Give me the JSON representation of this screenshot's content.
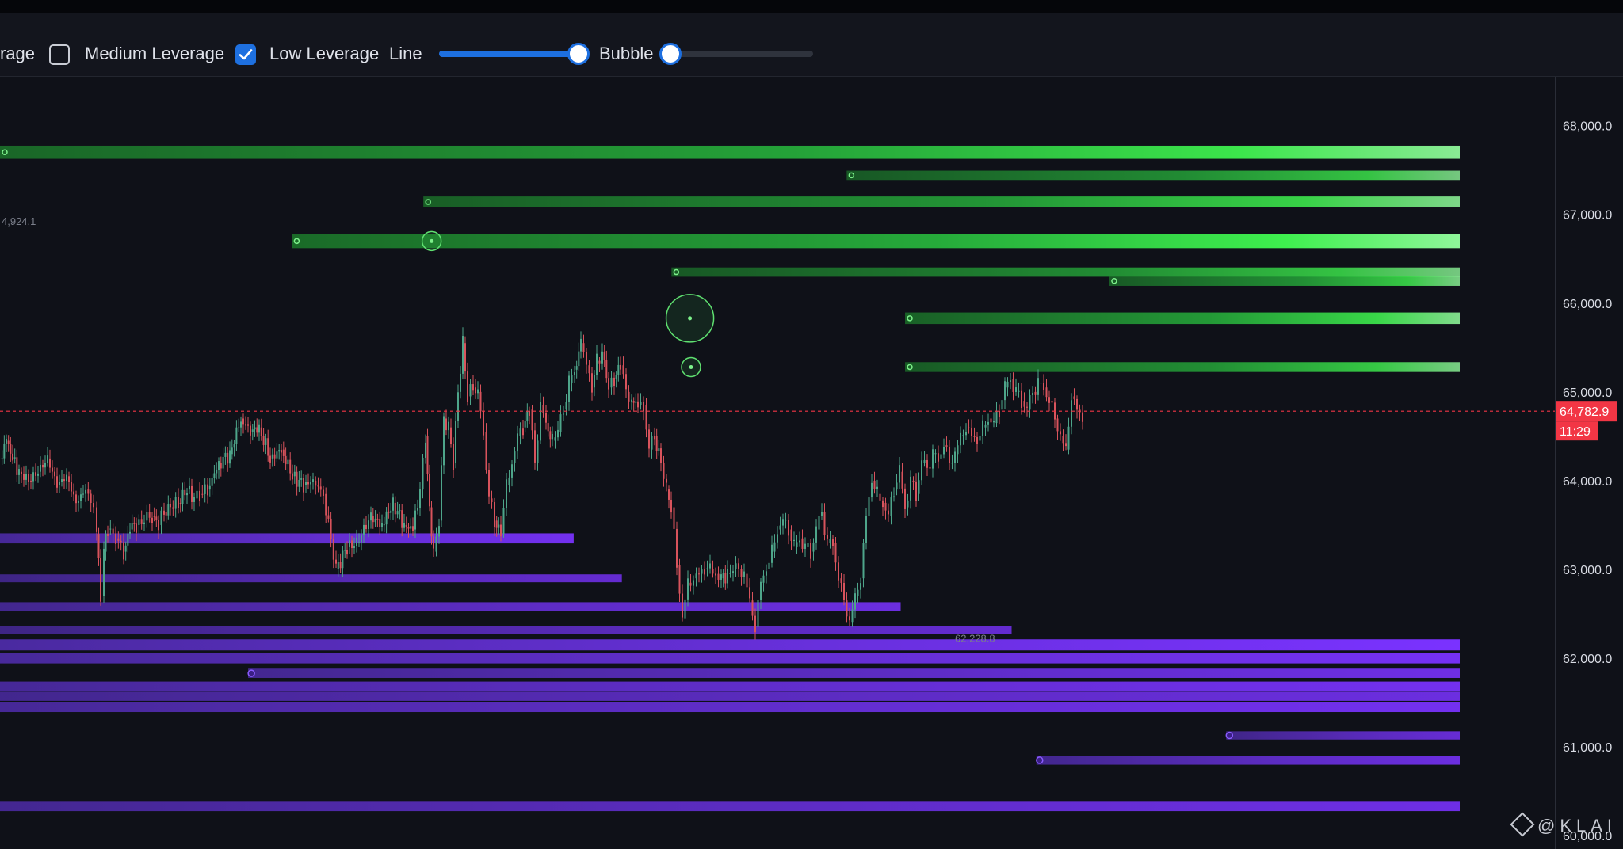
{
  "toolbar": {
    "partial_label": "rage",
    "medium_leverage": {
      "label": "Medium Leverage",
      "checked": false
    },
    "low_leverage": {
      "label": "Low Leverage",
      "checked": true
    },
    "line_label": "Line",
    "line_value": 0.98,
    "bubble_label": "Bubble",
    "bubble_value": 0.0
  },
  "chart_data": {
    "type": "line",
    "title": "",
    "ylim": [
      59850,
      68550
    ],
    "y_ticks": [
      68000,
      67000,
      66000,
      65000,
      64000,
      63000,
      62000,
      61000,
      60000
    ],
    "y_tick_labels": [
      "68,000.0",
      "67,000.0",
      "66,000.0",
      "65,000.0",
      "64,000.0",
      "63,000.0",
      "62,000.0",
      "61,000.0",
      "60,000.0"
    ],
    "current_price": {
      "value": 64782.9,
      "label": "64,782.9",
      "countdown": "11:29"
    },
    "annotations": [
      {
        "text": "4,924.1",
        "value": 66924.1
      },
      {
        "text": "62,228.8",
        "value": 62228.8
      }
    ],
    "price_series": {
      "name": "",
      "x": [
        0,
        8,
        16,
        24,
        36,
        48,
        60,
        72,
        84,
        96,
        108,
        118,
        122,
        127,
        131,
        136,
        146,
        156,
        164,
        172,
        182,
        192,
        200,
        207,
        215,
        225,
        236,
        245,
        252,
        262,
        276,
        290,
        304,
        316,
        327,
        341,
        355,
        369,
        383,
        395,
        408,
        424,
        438,
        450,
        468,
        482,
        496,
        510,
        521,
        530,
        537,
        542,
        547,
        554,
        560,
        566,
        572,
        578,
        584,
        590,
        597,
        603,
        610,
        617,
        624,
        632,
        639,
        646,
        653,
        660,
        668,
        675,
        682,
        689,
        697,
        704,
        711,
        718,
        725,
        733,
        740,
        747,
        753,
        760,
        768,
        775,
        783,
        790,
        797,
        805,
        812,
        819,
        826,
        834,
        841,
        847,
        854,
        861,
        868,
        875,
        882,
        889,
        896,
        903,
        910,
        918,
        925,
        932,
        939,
        946,
        953,
        960,
        967,
        974,
        981,
        988,
        995,
        1002,
        1009,
        1016,
        1023,
        1030,
        1037,
        1044,
        1051,
        1058,
        1065,
        1072,
        1079,
        1086,
        1093,
        1100,
        1107,
        1114,
        1121,
        1128,
        1135,
        1142,
        1149,
        1156,
        1163,
        1170,
        1177,
        1184,
        1191,
        1198,
        1205,
        1212,
        1219,
        1226,
        1233,
        1240,
        1247,
        1254,
        1261,
        1268,
        1275,
        1282,
        1289,
        1296,
        1303,
        1310,
        1317,
        1324,
        1331,
        1338,
        1345,
        1352,
        1359,
        1366,
        1373,
        1380,
        1387,
        1394,
        1401,
        1408
      ],
      "y": [
        64250,
        64450,
        64250,
        64100,
        64000,
        64100,
        64250,
        63950,
        64050,
        63750,
        63900,
        63700,
        63400,
        62700,
        63200,
        63450,
        63350,
        63200,
        63450,
        63500,
        63550,
        63600,
        63500,
        63650,
        63700,
        63750,
        63900,
        63800,
        63850,
        63900,
        64200,
        64300,
        64700,
        64550,
        64600,
        64250,
        64350,
        64050,
        63950,
        64000,
        63850,
        63000,
        63250,
        63300,
        63600,
        63500,
        63750,
        63500,
        63450,
        63900,
        64500,
        63700,
        63200,
        63550,
        64700,
        64600,
        64200,
        65000,
        65550,
        64950,
        65050,
        65000,
        64550,
        63800,
        63550,
        63400,
        63950,
        64200,
        64500,
        64600,
        64800,
        64200,
        64850,
        64650,
        64450,
        64550,
        64800,
        65100,
        65250,
        65550,
        65300,
        65050,
        65350,
        65450,
        65050,
        65150,
        65300,
        65000,
        64900,
        64850,
        64850,
        64350,
        64500,
        64200,
        63900,
        63700,
        63050,
        62450,
        62850,
        62900,
        62950,
        63000,
        63000,
        62950,
        62900,
        62950,
        63000,
        63000,
        62950,
        62650,
        62350,
        62850,
        63000,
        63200,
        63450,
        63550,
        63450,
        63250,
        63350,
        63250,
        63200,
        63450,
        63650,
        63300,
        63300,
        62900,
        62650,
        62400,
        62700,
        62900,
        63600,
        64000,
        63850,
        63750,
        63600,
        63900,
        64100,
        63700,
        64000,
        63850,
        64200,
        64150,
        64300,
        64250,
        64400,
        64200,
        64300,
        64500,
        64600,
        64500,
        64450,
        64600,
        64700,
        64650,
        64800,
        65050,
        65150,
        65000,
        64900,
        64800,
        65000,
        65100,
        65050,
        64900,
        64700,
        64500,
        64350,
        64950,
        64800,
        64700
      ]
    },
    "long_liquidation_levels": [
      {
        "value": 67700,
        "start": 0.0,
        "peak": 0.95,
        "intensity": 0.9
      },
      {
        "value": 67440,
        "start": 0.58,
        "peak": 0.7,
        "intensity": 0.55
      },
      {
        "value": 67140,
        "start": 0.29,
        "peak": 0.8,
        "intensity": 0.7
      },
      {
        "value": 66700,
        "start": 0.2,
        "peak": 1.0,
        "intensity": 1.0
      },
      {
        "value": 66350,
        "start": 0.46,
        "peak": 0.75,
        "intensity": 0.55
      },
      {
        "value": 66250,
        "start": 0.76,
        "peak": 0.8,
        "intensity": 0.6
      },
      {
        "value": 65830,
        "start": 0.62,
        "peak": 0.9,
        "intensity": 0.75
      },
      {
        "value": 65280,
        "start": 0.62,
        "peak": 0.7,
        "intensity": 0.6
      }
    ],
    "short_liquidation_levels": [
      {
        "value": 63350,
        "start": 0.0,
        "end": 0.393,
        "intensity": 0.85
      },
      {
        "value": 62900,
        "start": 0.0,
        "end": 0.426,
        "intensity": 0.55
      },
      {
        "value": 62580,
        "start": 0.0,
        "end": 0.617,
        "intensity": 0.7
      },
      {
        "value": 62320,
        "start": 0.0,
        "end": 0.693,
        "intensity": 0.55
      },
      {
        "value": 62150,
        "start": 0.0,
        "end": 1.0,
        "intensity": 1.0
      },
      {
        "value": 62000,
        "start": 0.0,
        "end": 1.0,
        "intensity": 0.9
      },
      {
        "value": 61830,
        "start": 0.17,
        "end": 1.0,
        "intensity": 0.75
      },
      {
        "value": 61680,
        "start": 0.0,
        "end": 1.0,
        "intensity": 0.85
      },
      {
        "value": 61570,
        "start": 0.0,
        "end": 1.0,
        "intensity": 0.7
      },
      {
        "value": 61450,
        "start": 0.0,
        "end": 1.0,
        "intensity": 0.85
      },
      {
        "value": 61130,
        "start": 0.84,
        "end": 1.0,
        "intensity": 0.6
      },
      {
        "value": 60850,
        "start": 0.71,
        "end": 1.0,
        "intensity": 0.7
      },
      {
        "value": 60330,
        "start": 0.0,
        "end": 1.0,
        "intensity": 0.75
      }
    ],
    "bubbles": [
      {
        "x": 386,
        "value": 66700,
        "size": "small"
      },
      {
        "x": 617,
        "value": 65830,
        "size": "large"
      },
      {
        "x": 618,
        "value": 65280,
        "size": "small"
      }
    ],
    "grid": false,
    "colors": {
      "background": "#0f1118",
      "long_levels": "#3ef04e",
      "short_levels": "#7a32ff",
      "candle_up": "#4ea58a",
      "candle_down": "#d8535c",
      "current_price": "#f23645"
    }
  },
  "watermark": {
    "text": "@KLAI"
  }
}
